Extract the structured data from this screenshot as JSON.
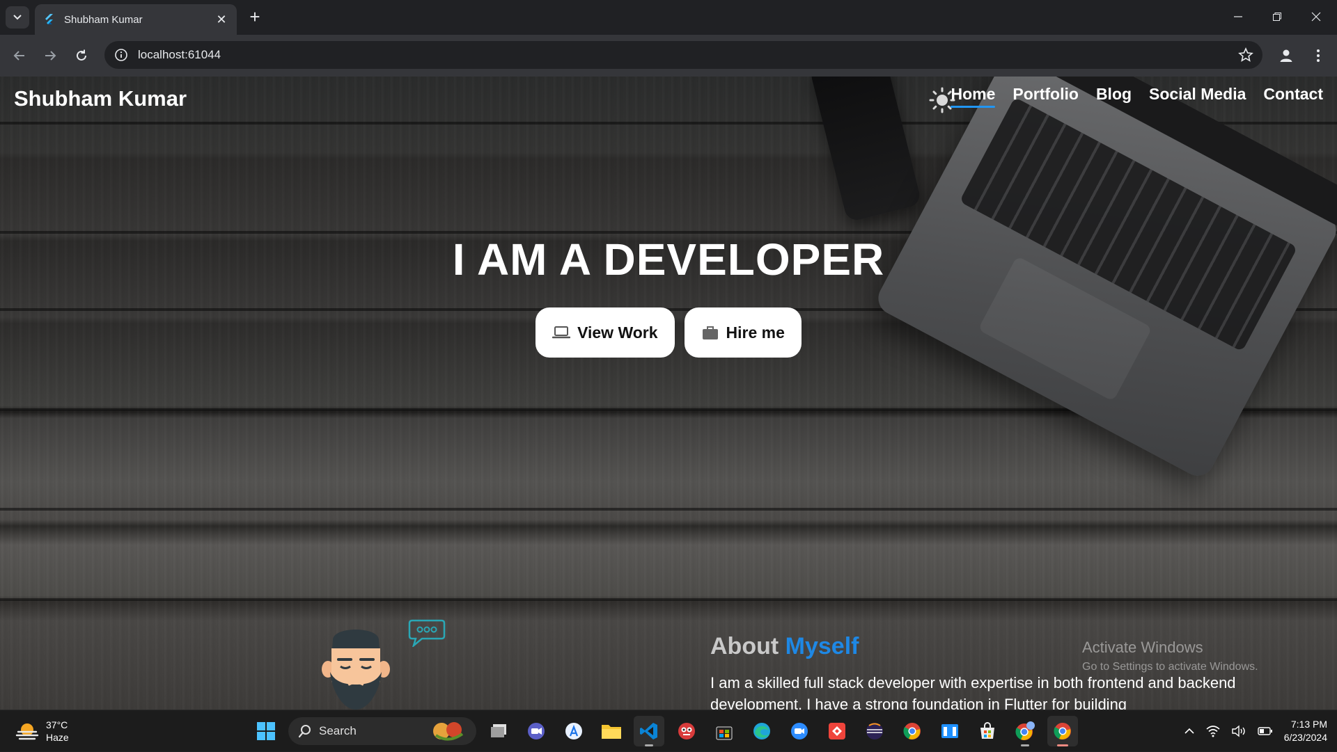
{
  "browser": {
    "tab_title": "Shubham Kumar",
    "url": "localhost:61044"
  },
  "site": {
    "brand": "Shubham Kumar",
    "nav": [
      "Home",
      "Portfolio",
      "Blog",
      "Social Media",
      "Contact"
    ],
    "active_nav": "Home",
    "hero_title": "I AM A DEVELOPER",
    "buttons": {
      "view_work": "View Work",
      "hire_me": "Hire me"
    },
    "about": {
      "title_prefix": "About",
      "title_highlight": "Myself",
      "text": "I am a skilled full stack developer with expertise in both frontend and backend development. I have a strong foundation in Flutter for building"
    },
    "accent_color": "#2196f3"
  },
  "watermark": {
    "line1": "Activate Windows",
    "line2": "Go to Settings to activate Windows."
  },
  "taskbar": {
    "weather_temp": "37°C",
    "weather_desc": "Haze",
    "search_label": "Search",
    "time": "7:13 PM",
    "date": "6/23/2024"
  }
}
